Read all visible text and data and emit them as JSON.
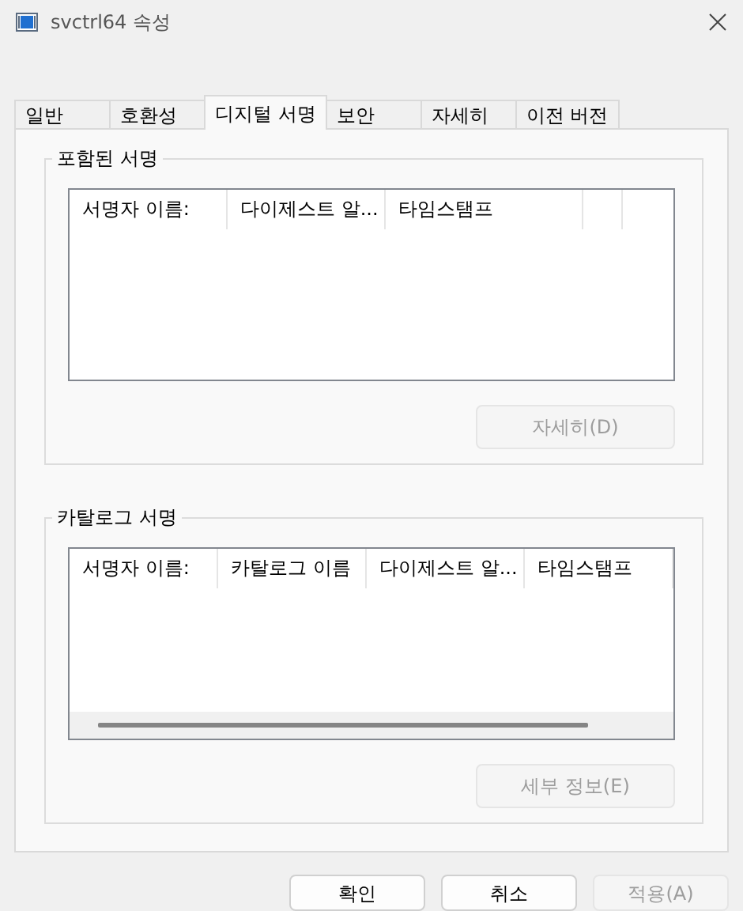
{
  "window": {
    "title": "svctrl64 속성"
  },
  "tabs": [
    {
      "label": "일반",
      "selected": false
    },
    {
      "label": "호환성",
      "selected": false
    },
    {
      "label": "디지털 서명",
      "selected": true
    },
    {
      "label": "보안",
      "selected": false
    },
    {
      "label": "자세히",
      "selected": false
    },
    {
      "label": "이전 버전",
      "selected": false
    }
  ],
  "groups": [
    {
      "title": "포함된 서명",
      "columns": [
        "서명자 이름:",
        "다이제스트 알...",
        "타임스탬프",
        ""
      ],
      "horizontal_scrollbar": false,
      "button": {
        "label": "자세히(D)",
        "disabled": true
      }
    },
    {
      "title": "카탈로그 서명",
      "columns": [
        "서명자 이름:",
        "카탈로그 이름",
        "다이제스트 알...",
        "타임스탬프"
      ],
      "horizontal_scrollbar": true,
      "button": {
        "label": "세부 정보(E)",
        "disabled": true
      }
    }
  ],
  "buttons": [
    {
      "label": "확인",
      "disabled": false
    },
    {
      "label": "취소",
      "disabled": false
    },
    {
      "label": "적용(A)",
      "disabled": true
    }
  ]
}
